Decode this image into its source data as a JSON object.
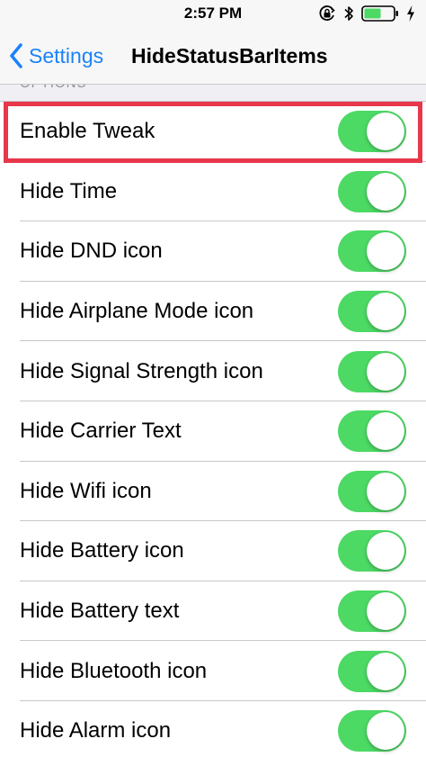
{
  "status_bar": {
    "time": "2:57 PM",
    "icons": [
      "orientation-lock-icon",
      "bluetooth-icon",
      "battery-icon",
      "charging-bolt-icon"
    ],
    "battery_color": "#4cd964"
  },
  "nav": {
    "back_label": "Settings",
    "title": "HideStatusBarItems"
  },
  "section": {
    "header": "OPTIONS"
  },
  "colors": {
    "accent": "#1a82fb",
    "switch_on": "#4cd964",
    "highlight": "#e8364a"
  },
  "rows": [
    {
      "label": "Enable Tweak",
      "on": true
    },
    {
      "label": "Hide Time",
      "on": true
    },
    {
      "label": "Hide DND icon",
      "on": true
    },
    {
      "label": "Hide Airplane Mode icon",
      "on": true
    },
    {
      "label": "Hide Signal Strength icon",
      "on": true
    },
    {
      "label": "Hide Carrier Text",
      "on": true
    },
    {
      "label": "Hide Wifi icon",
      "on": true
    },
    {
      "label": "Hide Battery icon",
      "on": true
    },
    {
      "label": "Hide Battery text",
      "on": true
    },
    {
      "label": "Hide Bluetooth icon",
      "on": true
    },
    {
      "label": "Hide Alarm icon",
      "on": true
    }
  ]
}
